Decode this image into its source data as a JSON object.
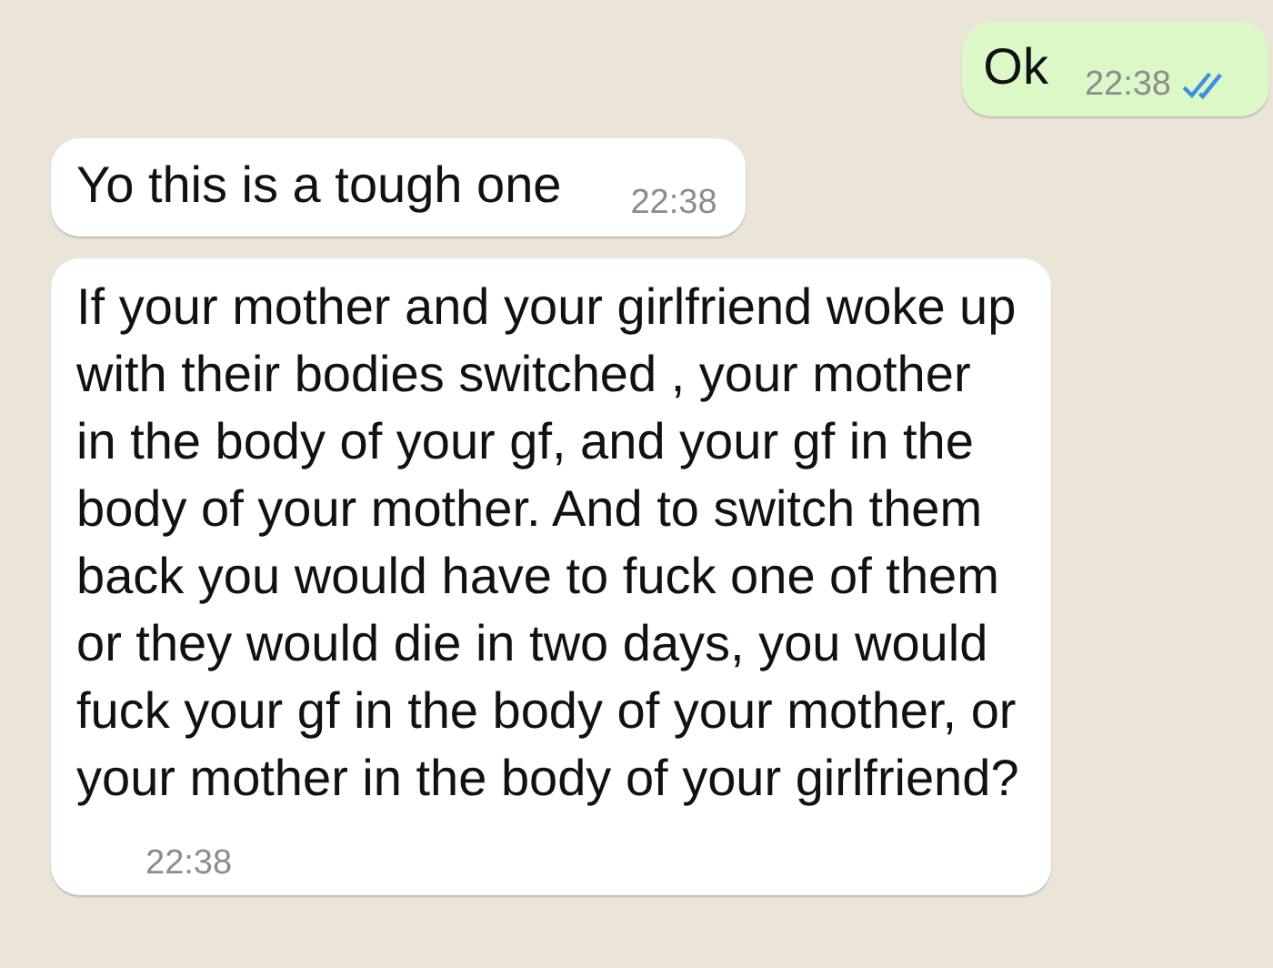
{
  "messages": [
    {
      "kind": "outgoing",
      "text": "Ok",
      "time": "22:38",
      "read": true
    },
    {
      "kind": "incoming",
      "text": "Yo this is a tough one",
      "time": "22:38"
    },
    {
      "kind": "incoming",
      "text": "If your mother and your girlfriend woke up with their bodies switched , your mother in the body of your gf, and your gf in the body of your mother. And to switch them back you would have to fuck one of them or they would die in two days, you would fuck your gf in the body of your mother, or your mother in the body of your girlfriend?",
      "time": "22:38"
    }
  ]
}
